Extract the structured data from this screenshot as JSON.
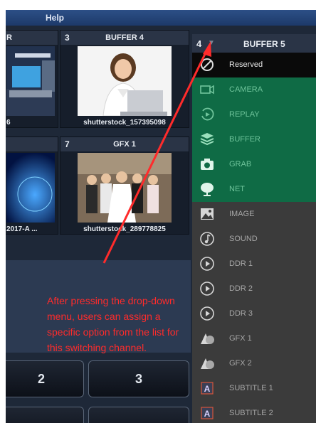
{
  "menubar": {
    "help": "Help"
  },
  "tiles": [
    {
      "num": "",
      "name": "R",
      "caption": "6"
    },
    {
      "num": "3",
      "name": "BUFFER 4",
      "caption": "shutterstock_157395098"
    },
    {
      "num": "",
      "name": "",
      "caption": "2017-A ..."
    },
    {
      "num": "7",
      "name": "GFX 1",
      "caption": "shutterstock_289778825"
    }
  ],
  "dropdown": {
    "number": "4",
    "title": "BUFFER 5",
    "items": [
      {
        "label": "Reserved",
        "icon": "reserved-icon"
      },
      {
        "label": "CAMERA",
        "icon": "camera-icon"
      },
      {
        "label": "REPLAY",
        "icon": "replay-icon"
      },
      {
        "label": "BUFFER",
        "icon": "buffer-icon"
      },
      {
        "label": "GRAB",
        "icon": "grab-camera-icon"
      },
      {
        "label": "NET",
        "icon": "net-tree-icon"
      },
      {
        "label": "IMAGE",
        "icon": "image-icon"
      },
      {
        "label": "SOUND",
        "icon": "sound-icon"
      },
      {
        "label": "DDR 1",
        "icon": "play-circle-icon"
      },
      {
        "label": "DDR 2",
        "icon": "play-circle-icon"
      },
      {
        "label": "DDR 3",
        "icon": "play-circle-icon"
      },
      {
        "label": "GFX 1",
        "icon": "gfx-shapes-icon"
      },
      {
        "label": "GFX 2",
        "icon": "gfx-shapes-icon"
      },
      {
        "label": "SUBTITLE 1",
        "icon": "subtitle-icon"
      },
      {
        "label": "SUBTITLE 2",
        "icon": "subtitle-icon"
      }
    ]
  },
  "buttons": [
    "2",
    "3"
  ],
  "annotation": {
    "text": "After pressing the drop-down menu, users can assign a specific option from the list for this switching channel."
  },
  "colors": {
    "green_group": "#0f6b45",
    "annotation": "#ff2b2b",
    "selected_item": "#0a0a0a"
  }
}
